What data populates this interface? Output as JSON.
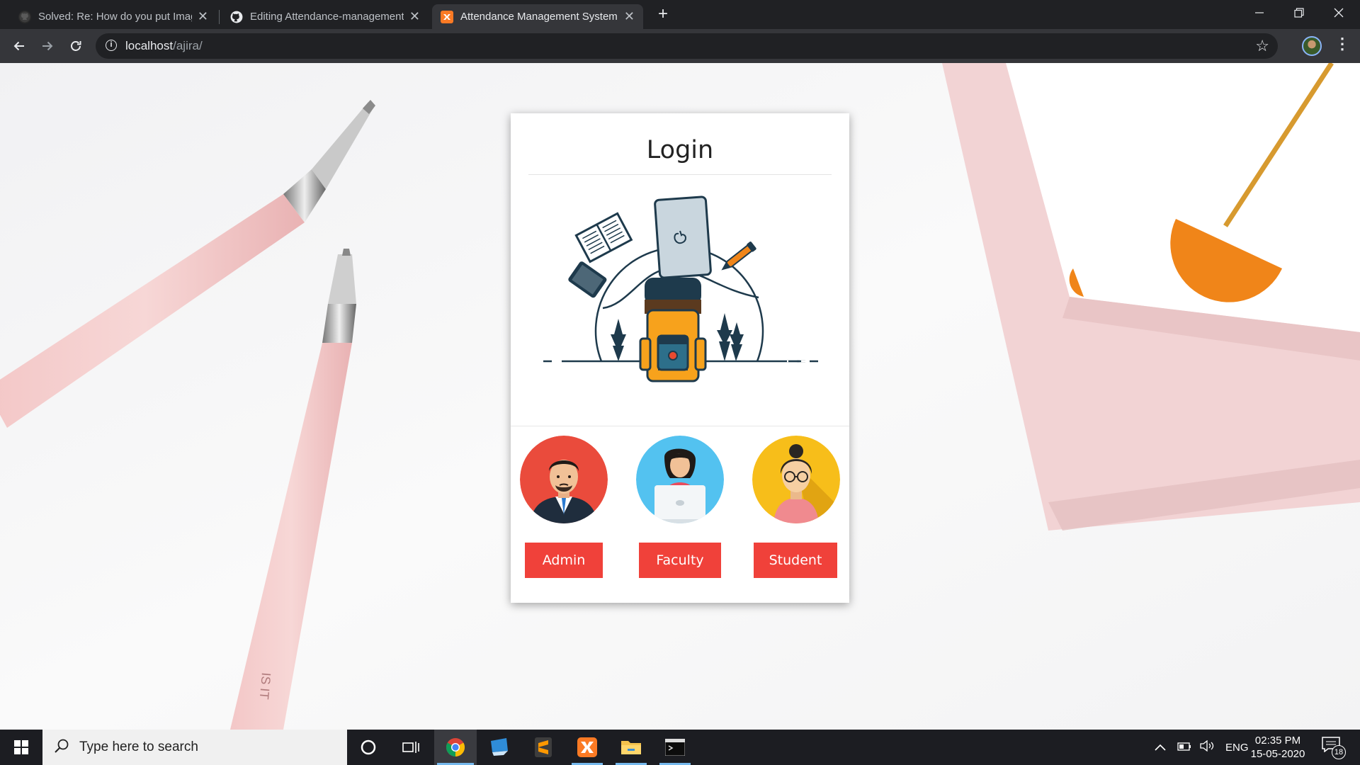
{
  "browser": {
    "tabs": [
      {
        "title": "Solved: Re: How do you put Imag",
        "favicon": "github-icon"
      },
      {
        "title": "Editing Attendance-management",
        "favicon": "github-icon"
      },
      {
        "title": "Attendance Management System",
        "favicon": "xampp-icon",
        "active": true
      }
    ],
    "new_tab_label": "+",
    "url_host": "localhost",
    "url_path": "/ajira/"
  },
  "page": {
    "title": "Login",
    "roles": [
      {
        "label": "Admin",
        "color": "#ea4b3c"
      },
      {
        "label": "Faculty",
        "color": "#53c2f0"
      },
      {
        "label": "Student",
        "color": "#f7be1a"
      }
    ],
    "button_color": "#f0413a"
  },
  "taskbar": {
    "search_placeholder": "Type here to search",
    "language": "ENG",
    "time": "02:35 PM",
    "date": "15-05-2020",
    "notification_count": "18"
  }
}
